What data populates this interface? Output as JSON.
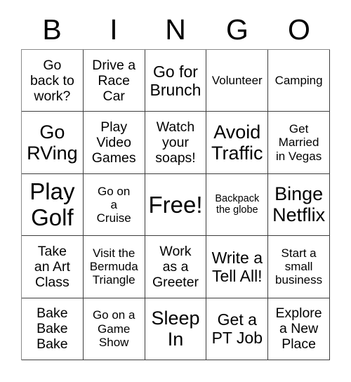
{
  "header": {
    "letters": [
      "B",
      "I",
      "N",
      "G",
      "O"
    ]
  },
  "grid": {
    "rows": 5,
    "columns": 5,
    "border_color": "#3d3d3d",
    "background_color": "#ffffff",
    "text_color": "#000000",
    "cells": [
      {
        "text": "Go\nback to\nwork?",
        "size": "m"
      },
      {
        "text": "Drive a\nRace\nCar",
        "size": "m"
      },
      {
        "text": "Go for\nBrunch",
        "size": "l"
      },
      {
        "text": "Volunteer",
        "size": "s"
      },
      {
        "text": "Camping",
        "size": "s"
      },
      {
        "text": "Go\nRVing",
        "size": "xl"
      },
      {
        "text": "Play\nVideo\nGames",
        "size": "m"
      },
      {
        "text": "Watch\nyour\nsoaps!",
        "size": "m"
      },
      {
        "text": "Avoid\nTraffic",
        "size": "xl"
      },
      {
        "text": "Get\nMarried\nin Vegas",
        "size": "s"
      },
      {
        "text": "Play\nGolf",
        "size": "xxl"
      },
      {
        "text": "Go on\na\nCruise",
        "size": "s"
      },
      {
        "text": "Free!",
        "size": "xxl"
      },
      {
        "text": "Backpack\nthe globe",
        "size": "xs"
      },
      {
        "text": "Binge\nNetflix",
        "size": "xl"
      },
      {
        "text": "Take\nan Art\nClass",
        "size": "m"
      },
      {
        "text": "Visit the\nBermuda\nTriangle",
        "size": "s"
      },
      {
        "text": "Work\nas a\nGreeter",
        "size": "m"
      },
      {
        "text": "Write a\nTell All!",
        "size": "l"
      },
      {
        "text": "Start a\nsmall\nbusiness",
        "size": "s"
      },
      {
        "text": "Bake\nBake\nBake",
        "size": "m"
      },
      {
        "text": "Go on a\nGame\nShow",
        "size": "s"
      },
      {
        "text": "Sleep\nIn",
        "size": "xl"
      },
      {
        "text": "Get a\nPT Job",
        "size": "l"
      },
      {
        "text": "Explore\na New\nPlace",
        "size": "m"
      }
    ]
  }
}
